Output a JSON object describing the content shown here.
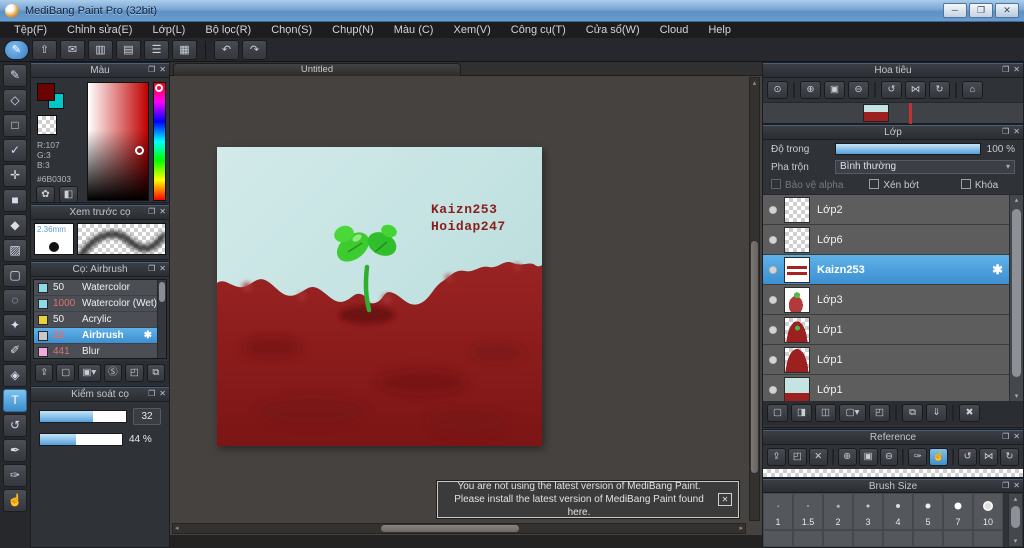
{
  "window": {
    "title": "MediBang Paint Pro (32bit)",
    "controls": {
      "minimize": "─",
      "restore": "❐",
      "close": "✕"
    }
  },
  "menu": {
    "items": [
      "Tệp(F)",
      "Chỉnh sửa(E)",
      "Lớp(L)",
      "Bộ lọc(R)",
      "Chọn(S)",
      "Chụp(N)",
      "Màu (C)",
      "Xem(V)",
      "Công cụ(T)",
      "Cửa sổ(W)",
      "Cloud",
      "Help"
    ]
  },
  "toolbar": {
    "buttons": [
      {
        "name": "medibang-cloud",
        "glyph": "✎"
      },
      {
        "name": "share",
        "glyph": "⇧"
      },
      {
        "name": "comment",
        "glyph": "✉"
      },
      {
        "name": "chat-panel",
        "glyph": "▥"
      },
      {
        "name": "document",
        "glyph": "▤"
      },
      {
        "name": "material-list",
        "glyph": "☰"
      },
      {
        "name": "grid-canvas",
        "glyph": "▦"
      },
      {
        "name": "undo",
        "glyph": "↶"
      },
      {
        "name": "redo",
        "glyph": "↷"
      }
    ]
  },
  "tools": {
    "items": [
      {
        "name": "brush-tool",
        "glyph": "✎"
      },
      {
        "name": "eraser-tool",
        "glyph": "◇"
      },
      {
        "name": "shape-brush-tool",
        "glyph": "□"
      },
      {
        "name": "control-point-tool",
        "glyph": "✓"
      },
      {
        "name": "move-tool",
        "glyph": "✛"
      },
      {
        "name": "fill-shape-tool",
        "glyph": "■"
      },
      {
        "name": "bucket-tool",
        "glyph": "◆"
      },
      {
        "name": "gradient-tool",
        "glyph": "▨"
      },
      {
        "name": "select-tool",
        "glyph": "▢"
      },
      {
        "name": "lasso-tool",
        "glyph": "◌"
      },
      {
        "name": "magic-wand-tool",
        "glyph": "✦"
      },
      {
        "name": "select-pen-tool",
        "glyph": "✐"
      },
      {
        "name": "select-eraser-tool",
        "glyph": "◈"
      },
      {
        "name": "text-tool",
        "glyph": "T"
      },
      {
        "name": "operation-tool",
        "glyph": "↺"
      },
      {
        "name": "pen-tool",
        "glyph": "✒"
      },
      {
        "name": "eyedropper-tool",
        "glyph": "✑"
      },
      {
        "name": "hand-tool",
        "glyph": "☝"
      }
    ]
  },
  "panel_icons": {
    "float": "❐",
    "close": "✕"
  },
  "color_panel": {
    "title": "Màu",
    "r": "R:107",
    "g": "G:3",
    "b": "B:3",
    "hex": "#6B0303",
    "foreground": "#6B0303",
    "background_color": "#00C8C8",
    "palette_glyph": "✿",
    "colorset_glyph": "◧"
  },
  "brush_preview": {
    "title": "Xem trước cọ",
    "size_label": "2.36mm"
  },
  "brush_panel": {
    "title": "Cọ: Airbrush",
    "gear_glyph": "✱",
    "brushes": [
      {
        "size": "50",
        "name": "Watercolor",
        "swatch": "#8fd9e8",
        "size_color": "#f0f0f0"
      },
      {
        "size": "1000",
        "name": "Watercolor (Wet)",
        "swatch": "#8fd9e8",
        "size_color": "#e07070"
      },
      {
        "size": "50",
        "name": "Acrylic",
        "swatch": "#e6d33e",
        "size_color": "#f0f0f0"
      },
      {
        "size": "32",
        "name": "Airbrush",
        "swatch": "#c9c9c9",
        "size_color": "#e07070"
      },
      {
        "size": "441",
        "name": "Blur",
        "swatch": "#f2aadd",
        "size_color": "#e07070"
      }
    ],
    "actions": [
      {
        "name": "cloud-brush",
        "glyph": "⇪"
      },
      {
        "name": "new-brush",
        "glyph": "▢"
      },
      {
        "name": "new-brush-dropdown",
        "glyph": "▣▾"
      },
      {
        "name": "script-brush",
        "glyph": "Ⓢ"
      },
      {
        "name": "brush-folder",
        "glyph": "◰"
      },
      {
        "name": "duplicate-brush",
        "glyph": "⧉"
      }
    ]
  },
  "brush_control": {
    "title": "Kiểm soát cọ",
    "size_value": "32",
    "opacity_value": "44 %"
  },
  "canvas": {
    "tab_title": "Untitled",
    "signature_line1": "Kaizn253",
    "signature_line2": "Hoidap247"
  },
  "navigator": {
    "title": "Hoa tiêu",
    "buttons": [
      {
        "name": "zoom-tool",
        "glyph": "⊙"
      },
      {
        "name": "zoom-in",
        "glyph": "⊕"
      },
      {
        "name": "fit-window",
        "glyph": "▣"
      },
      {
        "name": "zoom-out",
        "glyph": "⊖"
      },
      {
        "name": "rotate-left",
        "glyph": "↺"
      },
      {
        "name": "reset-rotation",
        "glyph": "⋈"
      },
      {
        "name": "rotate-right",
        "glyph": "↻"
      },
      {
        "name": "zoom-100",
        "glyph": "⌂"
      }
    ]
  },
  "layers_panel": {
    "title": "Lớp",
    "opacity_label": "Độ trong",
    "opacity_value": "100 %",
    "blend_label": "Pha trộn",
    "blend_value": "Bình thường",
    "alpha_label": "Bảo vệ alpha",
    "clip_label": "Xén bớt",
    "lock_label": "Khóa",
    "gear_glyph": "✱",
    "layers": [
      {
        "name": "Lớp2"
      },
      {
        "name": "Lớp6"
      },
      {
        "name": "Kaizn253"
      },
      {
        "name": "Lớp3"
      },
      {
        "name": "Lớp1"
      },
      {
        "name": "Lớp1"
      },
      {
        "name": "Lớp1"
      }
    ],
    "actions": [
      {
        "name": "new-layer",
        "glyph": "▢"
      },
      {
        "name": "new-halftone-layer",
        "glyph": "◨"
      },
      {
        "name": "new-1bit-layer",
        "glyph": "◫"
      },
      {
        "name": "add-layer-menu",
        "glyph": "▢▾"
      },
      {
        "name": "layer-folder",
        "glyph": "◰"
      },
      {
        "name": "duplicate-layer",
        "glyph": "⧉"
      },
      {
        "name": "merge-layer",
        "glyph": "⇓"
      },
      {
        "name": "delete-layer",
        "glyph": "✖"
      }
    ]
  },
  "reference_panel": {
    "title": "Reference",
    "buttons": [
      {
        "name": "cloud-reference",
        "glyph": "⇪"
      },
      {
        "name": "open-folder",
        "glyph": "◰"
      },
      {
        "name": "clear-reference",
        "glyph": "✕"
      },
      {
        "name": "zoom-in",
        "glyph": "⊕"
      },
      {
        "name": "fit-window",
        "glyph": "▣"
      },
      {
        "name": "zoom-out",
        "glyph": "⊖"
      },
      {
        "name": "eyedropper",
        "glyph": "✑"
      },
      {
        "name": "hand",
        "glyph": "☝"
      },
      {
        "name": "rotate-left",
        "glyph": "↺"
      },
      {
        "name": "reset-rotation",
        "glyph": "⋈"
      },
      {
        "name": "rotate-right",
        "glyph": "↻"
      }
    ]
  },
  "brush_size_panel": {
    "title": "Brush Size",
    "sizes": [
      "1",
      "1.5",
      "2",
      "3",
      "4",
      "5",
      "7",
      "10"
    ]
  },
  "notification": {
    "line1": "You are not using the latest version of MediBang Paint.",
    "line2": "Please install the latest version of MediBang Paint found here.",
    "close_glyph": "✕"
  },
  "scroll": {
    "up": "▴",
    "down": "▾",
    "left": "◂",
    "right": "▸"
  }
}
